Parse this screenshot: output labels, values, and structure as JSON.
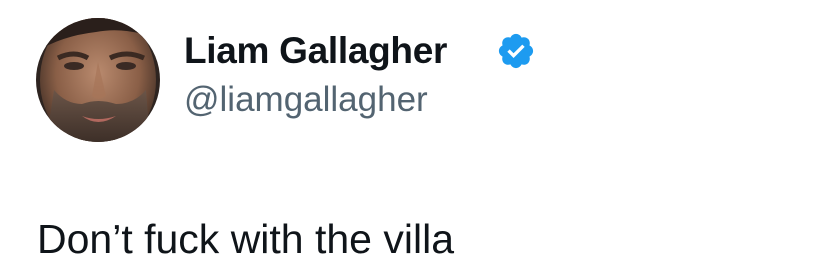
{
  "author": {
    "display_name": "Liam Gallagher",
    "handle": "@liamgallagher",
    "avatar_icon": "profile-photo",
    "verified_icon": "verified-badge-icon",
    "verified_color": "#1d9bf0"
  },
  "tweet": {
    "text": "Don’t fuck with the villa"
  },
  "colors": {
    "text_primary": "#0f1419",
    "text_secondary": "#536471",
    "background": "#ffffff"
  }
}
